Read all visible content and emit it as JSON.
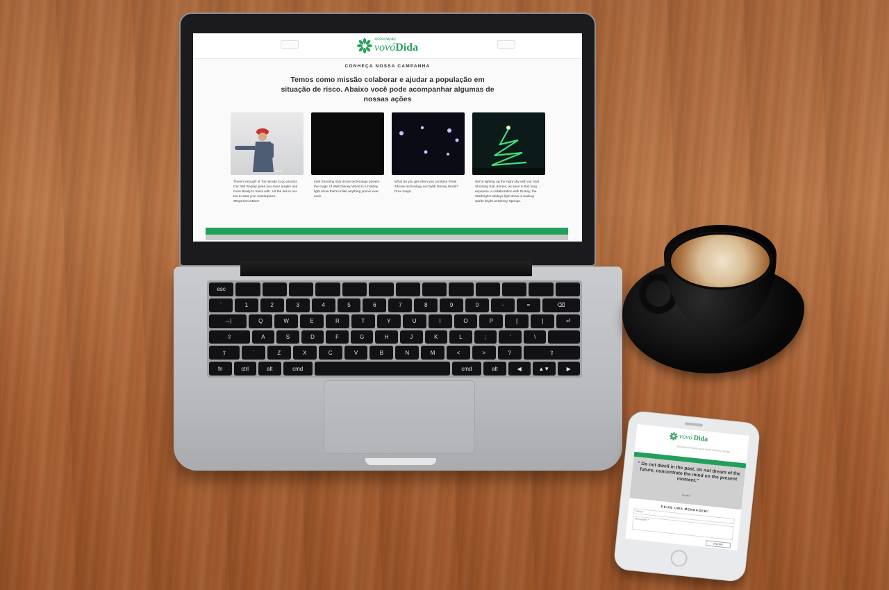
{
  "site": {
    "logo_small": "Associação",
    "logo_name_1": "vovó",
    "logo_name_2": "Dida",
    "header_left_button": "",
    "header_right_button": "",
    "section_title": "CONHEÇA NOSSA CAMPANHA",
    "headline": "Temos como missão colaborar e ajudar a população em situação de risco. Abaixo você pode acompanhar algumas de nossas ações",
    "cards": [
      {
        "image": "man-in-red-hat-photo",
        "caption": "There's enough of Tom Brady to go around. Our 360 Replay gives you more angles and more Brady to mess with. Hit the link in our bio to start your masterpiece. #ExperienceMore"
      },
      {
        "image": "dark-video-frame",
        "caption": "Intel Shooting Star drone technology powers the magic of Walt Disney World in a holiday light show that's unlike anything you've ever seen."
      },
      {
        "image": "drone-lights-night-photo",
        "caption": "What do you get when you combine #Intel #drone technology and Walt Disney World? Pure magic."
      },
      {
        "image": "drone-christmas-tree-photo",
        "caption": "We're lighting up the night sky with our Intel Shooting Star drones, as seen in this long exposure. A collaboration with Disney, the Starbright Holidays light show is making spirits bright at Disney Springs."
      }
    ]
  },
  "phone": {
    "tiny_text": "light show is making spirits bright at Disney Springs.",
    "quote": "\" Do not dwell in the past, do not dream of the future, concentrate the mind on the present moment.\"",
    "author": "Buddha",
    "form_title": "DEIXE UMA MENSAGEM!",
    "field_name": "Nome *",
    "field_message": "Mensagem *",
    "submit": "ENVIAR"
  },
  "keyboard": {
    "rows": [
      [
        "esc",
        "",
        "",
        "",
        "",
        "",
        "",
        "",
        "",
        "",
        "",
        "",
        "",
        ""
      ],
      [
        "`",
        "1",
        "2",
        "3",
        "4",
        "5",
        "6",
        "7",
        "8",
        "9",
        "0",
        "-",
        "=",
        "⌫"
      ],
      [
        "→|",
        "Q",
        "W",
        "E",
        "R",
        "T",
        "Y",
        "U",
        "I",
        "O",
        "P",
        "[",
        "]",
        "⏎"
      ],
      [
        "⇪",
        "A",
        "S",
        "D",
        "F",
        "G",
        "H",
        "J",
        "K",
        "L",
        ";",
        "'",
        "\\",
        ""
      ],
      [
        "⇧",
        "`",
        "Z",
        "X",
        "C",
        "V",
        "B",
        "N",
        "M",
        "<",
        ">",
        "?",
        "⇧"
      ],
      [
        "fn",
        "ctrl",
        "alt",
        "cmd",
        "",
        "cmd",
        "alt",
        "◀",
        "▲▼",
        "▶"
      ]
    ]
  },
  "colors": {
    "brand_green": "#21a05a",
    "wood": "#b06b3e"
  }
}
